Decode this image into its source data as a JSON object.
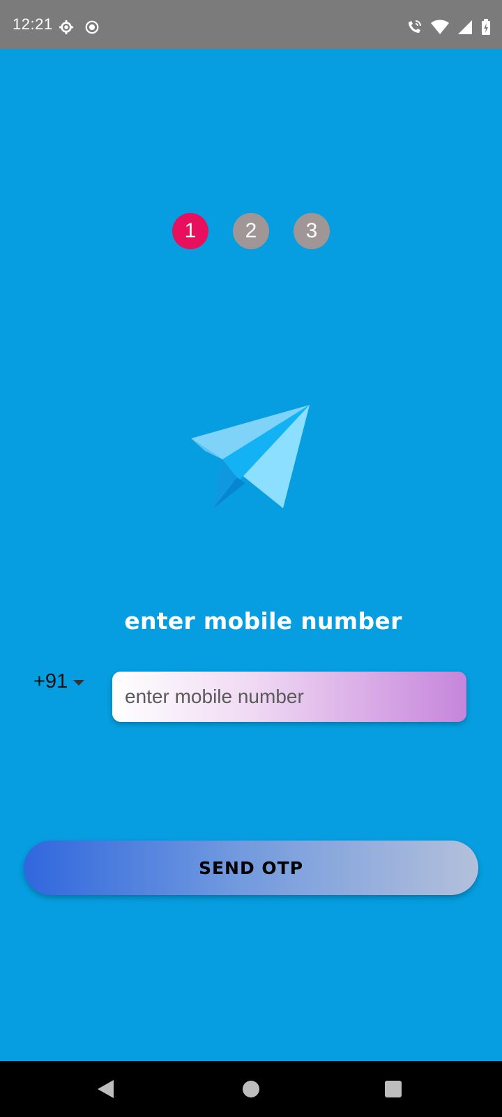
{
  "status_bar": {
    "time": "12:21",
    "left_icons": [
      "settings-icon",
      "record-icon"
    ],
    "right_icons": [
      "wifi-call-icon",
      "wifi-icon",
      "signal-icon",
      "battery-charging-icon"
    ]
  },
  "steps": [
    {
      "label": "1",
      "active": true
    },
    {
      "label": "2",
      "active": false
    },
    {
      "label": "3",
      "active": false
    }
  ],
  "illustration": "paper-plane-icon",
  "heading": "enter mobile number",
  "phone": {
    "country_code": "+91",
    "value": "",
    "placeholder": "enter mobile number"
  },
  "actions": {
    "send_otp_label": "SEND OTP"
  },
  "nav_bar": [
    "back-icon",
    "home-icon",
    "recents-icon"
  ],
  "colors": {
    "background": "#069ee0",
    "active_step": "#e8105d",
    "inactive_step": "#a09696"
  }
}
